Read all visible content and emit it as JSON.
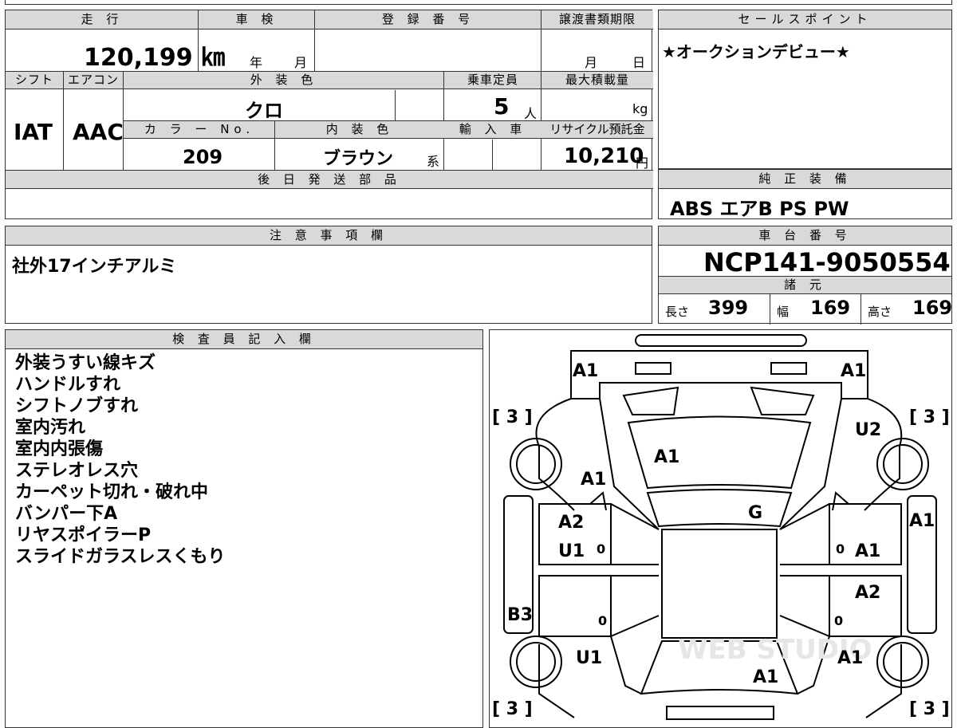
{
  "top_strip": {
    "fragment": "…"
  },
  "mileage": {
    "label": "走 行",
    "value": "120,199 ㎞"
  },
  "inspection": {
    "label": "車 検",
    "year_unit": "年",
    "month_unit": "月"
  },
  "registration": {
    "label": "登 録 番 号",
    "value": ""
  },
  "transfer_deadline": {
    "label": "譲渡書類期限",
    "month_unit": "月",
    "day_unit": "日"
  },
  "shift": {
    "label": "シフト",
    "value": "IAT"
  },
  "aircon": {
    "label": "エアコン",
    "value": "AAC"
  },
  "exterior_color": {
    "label": "外 装 色",
    "value": "クロ"
  },
  "capacity": {
    "label": "乗車定員",
    "value": "5",
    "unit": "人"
  },
  "max_load": {
    "label": "最大積載量",
    "unit": "kg"
  },
  "color_no": {
    "label": "カ ラ ー No.",
    "value": "209"
  },
  "interior_color": {
    "label": "内 装 色",
    "value": "ブラウン",
    "suffix": "系"
  },
  "import_car": {
    "label": "輸 入 車"
  },
  "recycle_fee": {
    "label": "リサイクル預託金",
    "value": "10,210",
    "unit": "円"
  },
  "later_parts": {
    "label": "後 日 発 送 部 品",
    "value": ""
  },
  "sales_point": {
    "label": "セールスポイント",
    "value": "★オークションデビュー★"
  },
  "genuine_equipment": {
    "label": "純 正 装 備",
    "value": "ABS エアB PS PW"
  },
  "notes": {
    "label": "注 意 事 項 欄",
    "value": "社外17インチアルミ"
  },
  "chassis_number": {
    "label": "車 台 番 号",
    "value": "NCP141-9050554"
  },
  "specs": {
    "label": "諸 元",
    "length_label": "長さ",
    "length": "399",
    "width_label": "幅",
    "width": "169",
    "height_label": "高さ",
    "height": "169"
  },
  "inspector": {
    "label": "検 査 員 記 入 欄",
    "remarks": [
      "外装うすい線キズ",
      "ハンドルすれ",
      "シフトノブすれ",
      "室内汚れ",
      "室内内張傷",
      "ステレオレス穴",
      "カーペット切れ・破れ中",
      "バンパー下A",
      "リヤスポイラーP",
      "スライドガラスレスくもり"
    ]
  },
  "diagram": {
    "codes": {
      "front_left": "A1",
      "front_right": "A1",
      "tire_fl": "[ 3 ]",
      "tire_fr": "[ 3 ]",
      "tire_rl": "[ 3 ]",
      "tire_rr": "[ 3 ]",
      "fender_right": "U2",
      "hood": "A1",
      "fender_left": "A1",
      "windshield": "G",
      "left_side": "A1",
      "left_door_front_1": "A2",
      "left_door_front_2": "U1",
      "left_mirror_tread": "0",
      "left_quarter": "B3",
      "left_door_rear_tread": "0",
      "right_door_front": "A1",
      "right_door_front_tread": "0",
      "right_door_rear": "A2",
      "right_door_rear_tread": "0",
      "rear_left": "U1",
      "rear_right": "A1",
      "rear": "A1"
    },
    "watermark": "WEB STUDIO"
  }
}
